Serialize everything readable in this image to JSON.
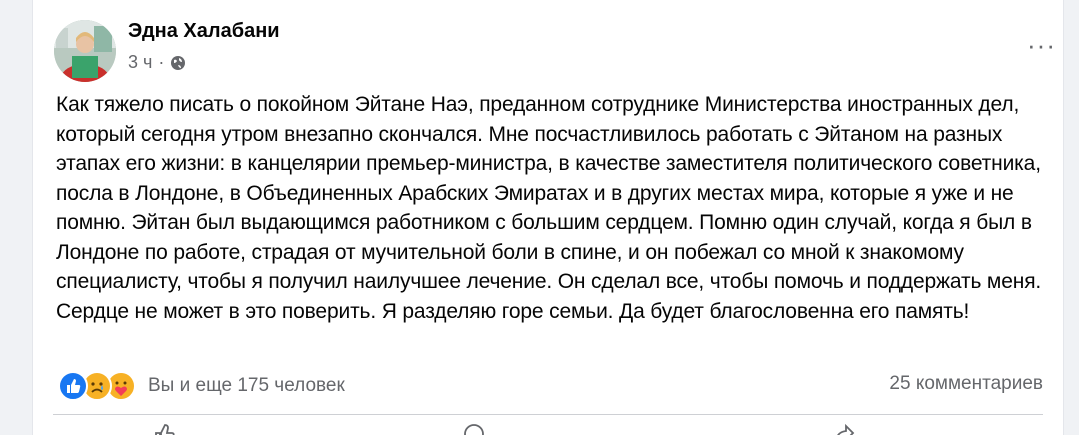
{
  "post": {
    "author": "Эдна Халабани",
    "time": "3 ч",
    "dot": "·",
    "audience_icon": "globe-icon",
    "more_icon": "more-horizontal-icon",
    "more_label": "···",
    "text": "Как тяжело писать о покойном Эйтане Наэ, преданном сотруднике Министерства иностранных дел, который сегодня утром внезапно скончался. Мне посчастливилось работать с Эйтаном на разных этапах его жизни: в канцелярии премьер-министра, в качестве заместителя политического советника, посла в Лондоне, в Объединенных Арабских Эмиратах и в других местах мира, которые я уже и не помню. Эйтан был выдающимся работником с большим сердцем. Помню один случай, когда я был в Лондоне по работе, страдая от мучительной боли в спине, и он побежал со мной к знакомому специалисту, чтобы я получил наилучшее лечение. Он сделал все, чтобы помочь и поддержать меня. Сердце не может в это поверить. Я разделяю горе семьи. Да будет благословенна его память!"
  },
  "reactions": {
    "icons": [
      "like-reaction-icon",
      "sad-reaction-icon",
      "care-reaction-icon"
    ],
    "summary": "Вы и еще 175 человек"
  },
  "comments": {
    "count_label": "25 комментариев"
  },
  "colors": {
    "primary_text": "#050505",
    "secondary_text": "#65676b",
    "like_blue": "#1877f2",
    "reaction_yellow": "#f7b125"
  }
}
